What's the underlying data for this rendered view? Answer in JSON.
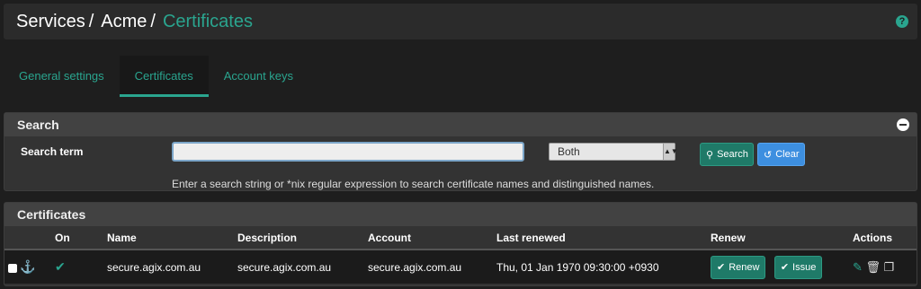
{
  "breadcrumb": {
    "items": [
      "Services",
      "Acme",
      "Certificates"
    ]
  },
  "tabs": [
    {
      "label": "General settings"
    },
    {
      "label": "Certificates"
    },
    {
      "label": "Account keys"
    }
  ],
  "search": {
    "title": "Search",
    "term_label": "Search term",
    "input_value": "",
    "select_value": "Both",
    "search_button": "Search",
    "clear_button": "Clear",
    "help": "Enter a search string or *nix regular expression to search certificate names and distinguished names."
  },
  "certificates": {
    "title": "Certificates",
    "columns": [
      "On",
      "Name",
      "Description",
      "Account",
      "Last renewed",
      "Renew",
      "Actions"
    ],
    "rows": [
      {
        "name": "secure.agix.com.au",
        "description": "secure.agix.com.au",
        "account": "secure.agix.com.au",
        "last_renewed": "Thu, 01 Jan 1970 09:30:00 +0930",
        "renew_label": "Renew",
        "issue_label": "Issue"
      }
    ]
  },
  "colors": {
    "accent": "#2aa58f",
    "button_green": "#1f7a68",
    "button_blue": "#3d8fe0"
  }
}
